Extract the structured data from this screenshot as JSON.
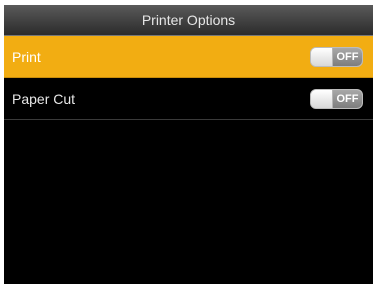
{
  "header": {
    "title": "Printer Options"
  },
  "settings": [
    {
      "label": "Print",
      "toggle_state": "OFF",
      "selected": true
    },
    {
      "label": "Paper Cut",
      "toggle_state": "OFF",
      "selected": false
    }
  ],
  "colors": {
    "selected_row": "#f2ad12",
    "background": "#000000",
    "header_gradient_top": "#5a5a5a",
    "header_gradient_bottom": "#2b2b2b"
  }
}
